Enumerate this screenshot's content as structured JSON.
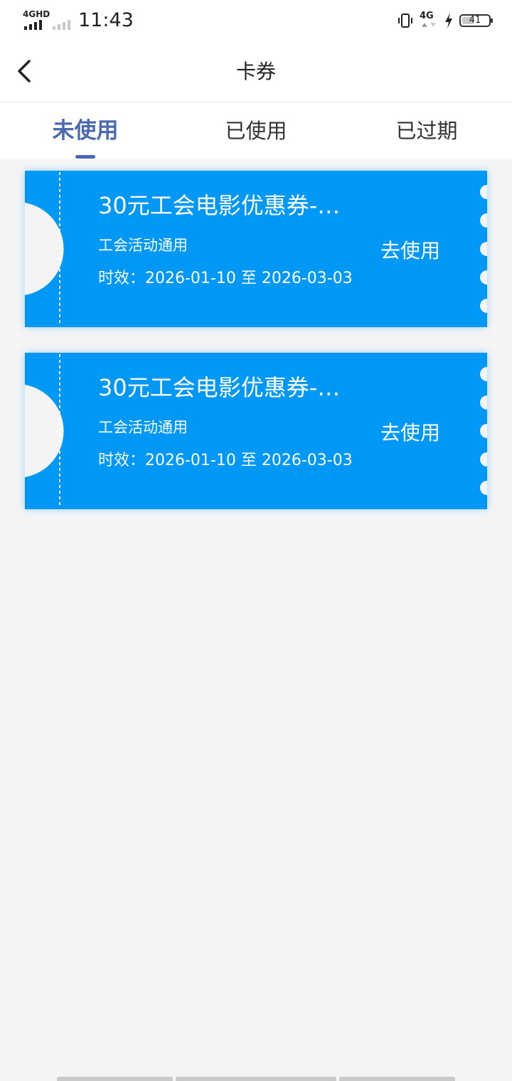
{
  "status_bar": {
    "network_label": "4GHD",
    "time": "11:43",
    "right_network_label": "4G",
    "battery_level": "41"
  },
  "nav": {
    "title": "卡券"
  },
  "tabs": [
    {
      "label": "未使用",
      "active": true
    },
    {
      "label": "已使用",
      "active": false
    },
    {
      "label": "已过期",
      "active": false
    }
  ],
  "coupons": [
    {
      "title": "30元工会电影优惠券-…",
      "scope": "工会活动通用",
      "validity": "时效：2026-01-10 至 2026-03-03",
      "action_label": "去使用"
    },
    {
      "title": "30元工会电影优惠券-…",
      "scope": "工会活动通用",
      "validity": "时效：2026-01-10 至 2026-03-03",
      "action_label": "去使用"
    }
  ],
  "colors": {
    "coupon_bg": "#0098f7",
    "accent": "#4a69b0",
    "page_bg": "#f4f4f4"
  }
}
